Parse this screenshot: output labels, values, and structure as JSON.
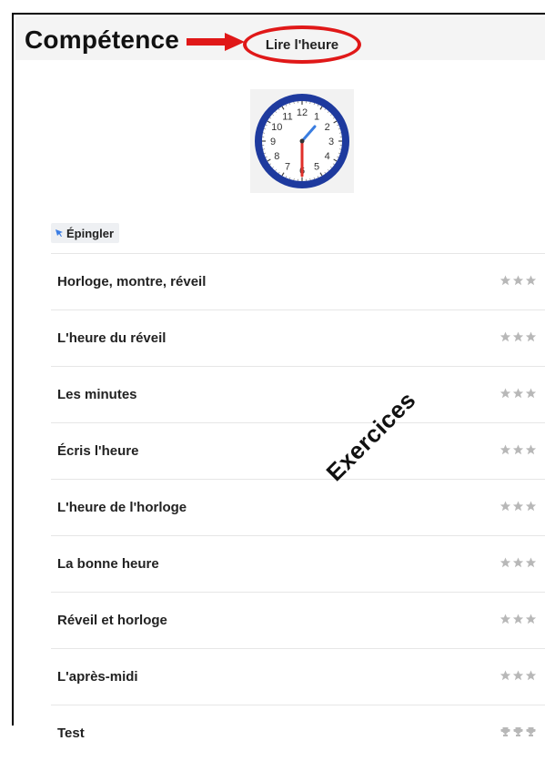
{
  "header": {
    "title": "Compétence",
    "skill_label": "Lire l'heure"
  },
  "pin_button": {
    "label": "Épingler"
  },
  "exercises": [
    {
      "label": "Horloge, montre, réveil",
      "icon": "stars"
    },
    {
      "label": "L'heure du réveil",
      "icon": "stars"
    },
    {
      "label": "Les minutes",
      "icon": "stars"
    },
    {
      "label": "Écris l'heure",
      "icon": "stars"
    },
    {
      "label": "L'heure de l'horloge",
      "icon": "stars"
    },
    {
      "label": "La bonne heure",
      "icon": "stars"
    },
    {
      "label": "Réveil et horloge",
      "icon": "stars"
    },
    {
      "label": "L'après-midi",
      "icon": "stars"
    },
    {
      "label": "Test",
      "icon": "trophies"
    }
  ],
  "annotation": {
    "text": "Exercices"
  },
  "clock": {
    "numbers": [
      "12",
      "1",
      "2",
      "3",
      "4",
      "5",
      "6",
      "7",
      "8",
      "9",
      "10",
      "11"
    ],
    "time_shown": "12:30"
  },
  "colors": {
    "accent_red": "#e01818",
    "clock_rim": "#1e3a9e",
    "minute_hand": "#e0302a",
    "hour_hand": "#3a7de0",
    "rating_gray": "#b8b8b8"
  }
}
